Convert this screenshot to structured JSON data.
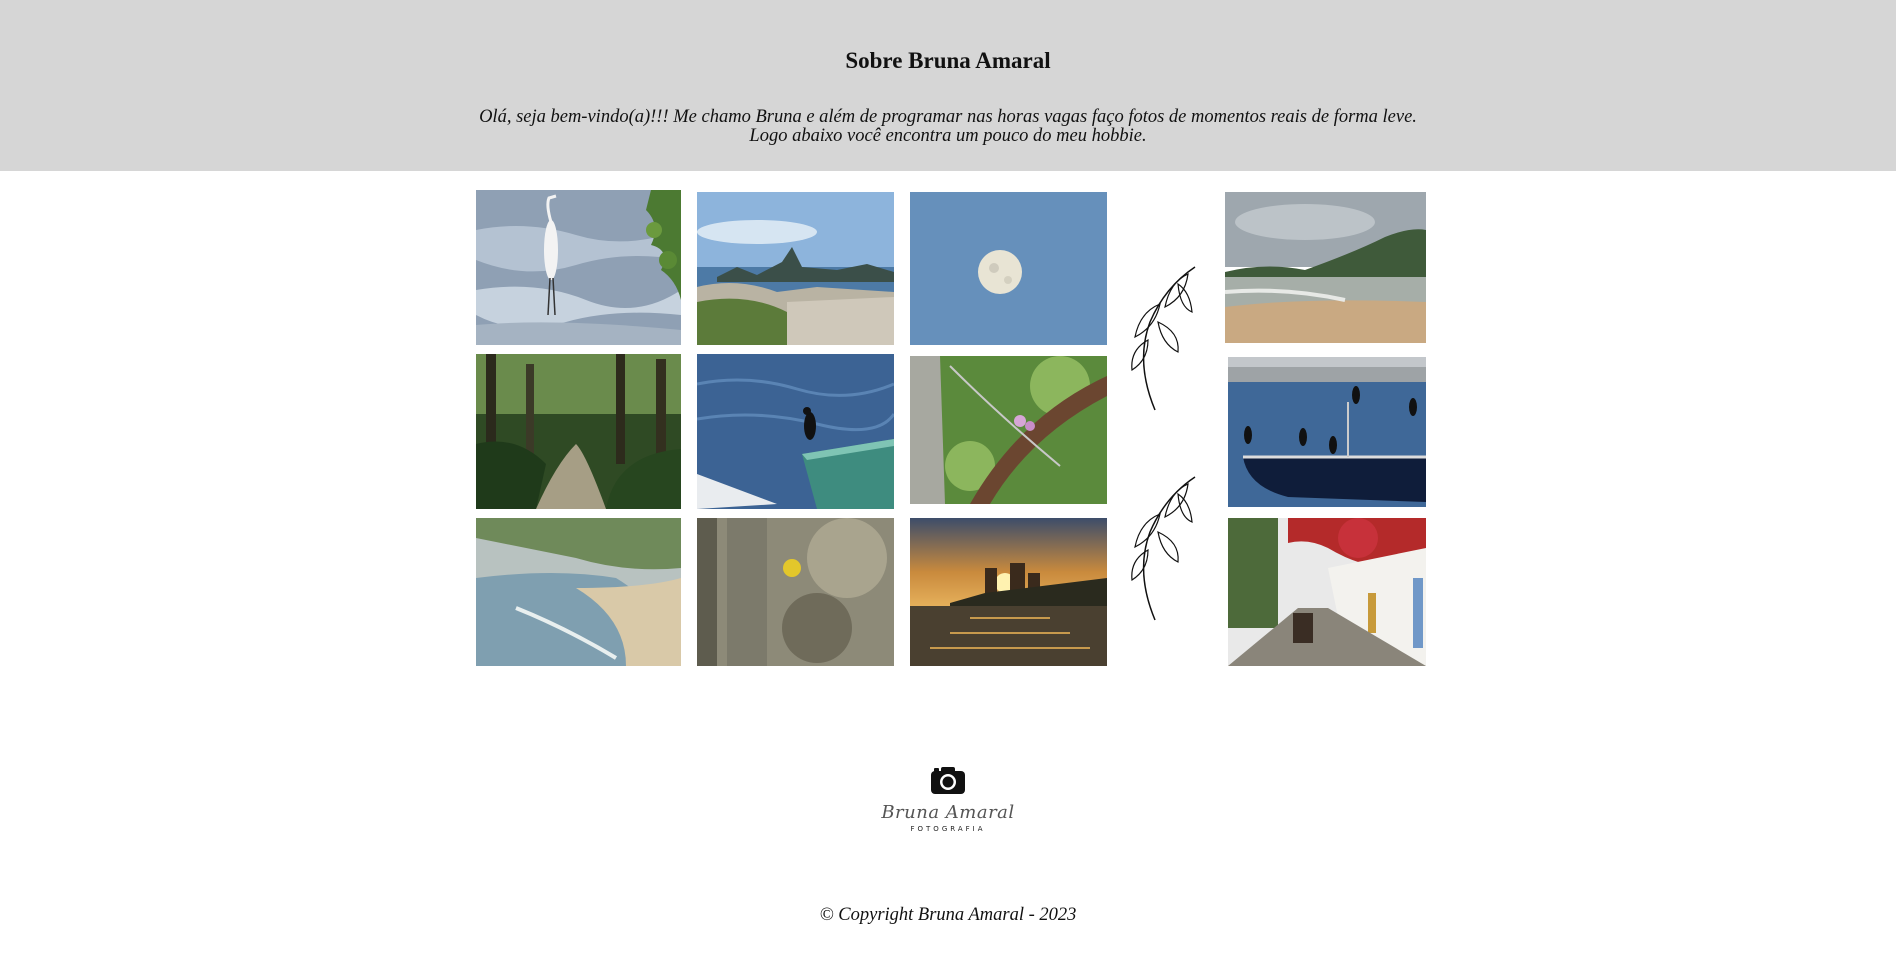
{
  "header": {
    "title": "Sobre Bruna Amaral",
    "intro_line1": "Olá, seja bem-vindo(a)!!! Me chamo Bruna e além de programar nas horas vagas faço fotos de momentos reais de forma leve.",
    "intro_line2": "Logo abaixo você encontra um pouco do meu hobbie."
  },
  "logo": {
    "icon": "camera-icon",
    "brand": "Bruna Amaral",
    "sub": "FOTOGRAFIA"
  },
  "footer": {
    "copyright": "© Copyright Bruna Amaral - 2023"
  },
  "colors": {
    "header_bg": "#d6d6d6",
    "page_bg": "#ffffff"
  }
}
